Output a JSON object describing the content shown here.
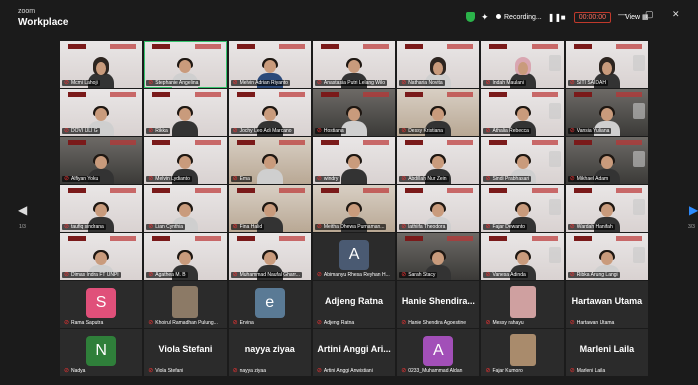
{
  "app": {
    "brand_top": "zoom",
    "brand_bottom": "Workplace"
  },
  "toolbar": {
    "recording_label": "Recording...",
    "timer": "00:00:00",
    "view_label": "View",
    "minimize": "—",
    "maximize": "▢",
    "close": "✕"
  },
  "pager": {
    "left": "1/3",
    "right": "3/3"
  },
  "icons": {
    "shield": "shield-icon",
    "sparkle": "sparkle-icon",
    "mic_muted": "mic-muted-icon",
    "prev": "chevron-left-icon",
    "next": "chevron-right-icon"
  },
  "colors": {
    "muted_mic": "#e33333",
    "active_speaker": "#36c36d",
    "accent": "#2d8cff"
  },
  "participants": [
    {
      "name": "Mcmi Lahoji"
    },
    {
      "name": "Stephanie Angelina"
    },
    {
      "name": "Melvin Adrian Riyanto"
    },
    {
      "name": "Anastasia Putri Lelang Wilo"
    },
    {
      "name": "Natharia Novita"
    },
    {
      "name": "Indah Maulani"
    },
    {
      "name": "SITI SAIDAH"
    },
    {
      "name": "DOVI ULI G"
    },
    {
      "name": "Rikka"
    },
    {
      "name": "Jochy Leo Adi Marcano"
    },
    {
      "name": "Hostiana"
    },
    {
      "name": "Dessy Kristiana"
    },
    {
      "name": "Athalia Rebecca"
    },
    {
      "name": "Vansia Yuliana"
    },
    {
      "name": "Alfiyan Yoku"
    },
    {
      "name": "Melvin Lydianto"
    },
    {
      "name": "Ema"
    },
    {
      "name": "windry"
    },
    {
      "name": "Abdillah Nur Zein"
    },
    {
      "name": "Sindi Prabhasari"
    },
    {
      "name": "Mikhael Adam"
    },
    {
      "name": "taufiq sindrana"
    },
    {
      "name": "Lian Cynthia"
    },
    {
      "name": "Fina Halid"
    },
    {
      "name": "Meitha Dhewa Purnaman..."
    },
    {
      "name": "lathiifa Theodora"
    },
    {
      "name": "Fajar Dewanto"
    },
    {
      "name": "Wardah Hanifah"
    },
    {
      "name": "Dimas Indra FT UNPI"
    },
    {
      "name": "Agathea M. B"
    },
    {
      "name": "Muhammad Naufal Gharr..."
    },
    {
      "name": "Abimanyu Rhesa Reyhan H...",
      "letter": "A"
    },
    {
      "name": "Sarah Stacy"
    },
    {
      "name": "Vanesa Adinda"
    },
    {
      "name": "Ribka Arung Langi"
    },
    {
      "name": "Rama Saputra",
      "letter": "S"
    },
    {
      "name": "Khoirul Ramadhan Pulung..."
    },
    {
      "name": "Ervina",
      "letter": "e"
    },
    {
      "name": "Adjeng Ratna",
      "big": "Adjeng Ratna"
    },
    {
      "name": "Hanie Shendira Agoestine",
      "big": "Hanie Shendira..."
    },
    {
      "name": "Messy rahayu"
    },
    {
      "name": "Hartawan Utama",
      "big": "Hartawan Utama"
    },
    {
      "name": "Nadya",
      "letter": "N"
    },
    {
      "name": "Viola Stefani",
      "big": "Viola Stefani"
    },
    {
      "name": "nayya ziyaa",
      "big": "nayya ziyaa"
    },
    {
      "name": "Artini Anggi Anwistiani",
      "big": "Artini Anggi Ari..."
    },
    {
      "name": "0233_Muhammad Aldan",
      "letter": "A"
    },
    {
      "name": "Fajar Kumoro"
    },
    {
      "name": "Marleni Laila",
      "big": "Marleni Laila"
    }
  ]
}
